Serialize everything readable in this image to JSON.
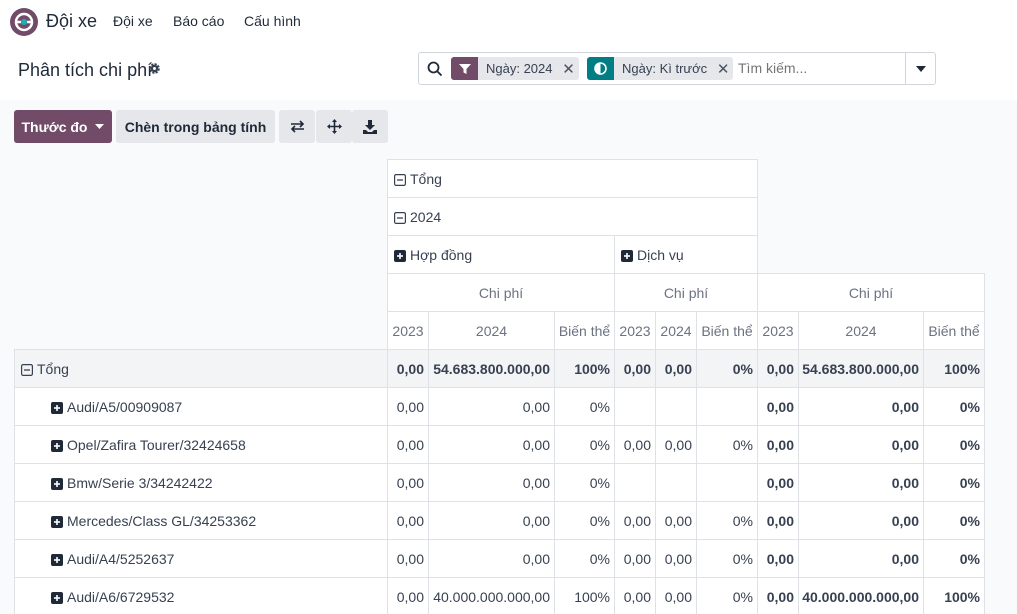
{
  "navbar": {
    "app_name": "Đội xe",
    "menu": [
      "Đội xe",
      "Báo cáo",
      "Cấu hình"
    ]
  },
  "control": {
    "title": "Phân tích chi phí",
    "facets": [
      {
        "label": "Ngày: 2024",
        "color": "#714b67",
        "icon": "filter-icon"
      },
      {
        "label": "Ngày: Kì trước",
        "color": "#017e84",
        "icon": "compare-icon"
      }
    ],
    "search_placeholder": "Tìm kiếm..."
  },
  "toolbar": {
    "measures_label": "Thước đo",
    "insert_label": "Chèn trong bảng tính",
    "icons": [
      "flip-axis-icon",
      "expand-all-icon",
      "download-icon"
    ]
  },
  "pivot": {
    "col_total": "Tổng",
    "col_year": "2024",
    "col_groups": [
      "Hợp đồng",
      "Dịch vụ"
    ],
    "measure": "Chi phí",
    "subcols": [
      "2023",
      "2024",
      "Biến thể"
    ],
    "row_total_label": "Tổng",
    "total_row": [
      "0,00",
      "54.683.800.000,00",
      "100%",
      "0,00",
      "0,00",
      "0%",
      "0,00",
      "54.683.800.000,00",
      "100%"
    ],
    "rows": [
      {
        "label": "Audi/A5/00909087",
        "cells": [
          "0,00",
          "0,00",
          "0%",
          "",
          "",
          "",
          "0,00",
          "0,00",
          "0%"
        ]
      },
      {
        "label": "Opel/Zafira Tourer/32424658",
        "cells": [
          "0,00",
          "0,00",
          "0%",
          "0,00",
          "0,00",
          "0%",
          "0,00",
          "0,00",
          "0%"
        ]
      },
      {
        "label": "Bmw/Serie 3/34242422",
        "cells": [
          "0,00",
          "0,00",
          "0%",
          "",
          "",
          "",
          "0,00",
          "0,00",
          "0%"
        ]
      },
      {
        "label": "Mercedes/Class GL/34253362",
        "cells": [
          "0,00",
          "0,00",
          "0%",
          "0,00",
          "0,00",
          "0%",
          "0,00",
          "0,00",
          "0%"
        ]
      },
      {
        "label": "Audi/A4/5252637",
        "cells": [
          "0,00",
          "0,00",
          "0%",
          "0,00",
          "0,00",
          "0%",
          "0,00",
          "0,00",
          "0%"
        ]
      },
      {
        "label": "Audi/A6/6729532",
        "cells": [
          "0,00",
          "40.000.000.000,00",
          "100%",
          "0,00",
          "0,00",
          "0%",
          "0,00",
          "40.000.000.000,00",
          "100%"
        ]
      }
    ]
  }
}
